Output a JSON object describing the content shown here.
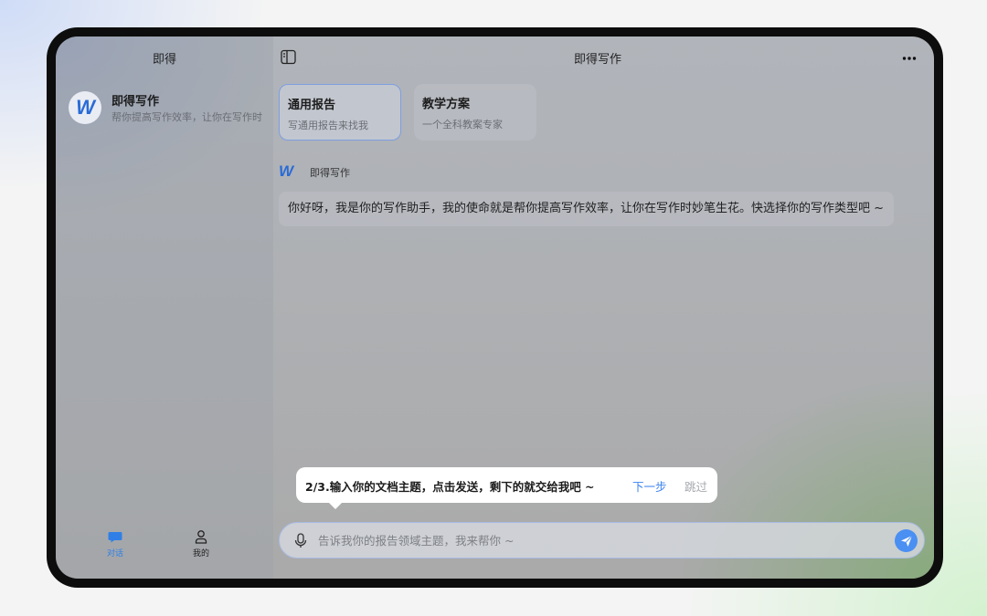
{
  "sidebar": {
    "title": "即得",
    "conversation": {
      "name": "即得写作",
      "preview": "帮你提高写作效率，让你在写作时妙笔生花",
      "logo_letter": "W"
    },
    "nav": [
      {
        "label": "对话",
        "icon": "chat-bubble-icon"
      },
      {
        "label": "我的",
        "icon": "user-icon"
      }
    ]
  },
  "header": {
    "title": "即得写作",
    "toggle_icon": "sidebar-toggle-icon",
    "more_icon": "more-icon"
  },
  "cards": [
    {
      "title": "通用报告",
      "subtitle": "写通用报告来找我"
    },
    {
      "title": "教学方案",
      "subtitle": "一个全科教案专家"
    }
  ],
  "message": {
    "sender": "即得写作",
    "logo_letter": "W",
    "text": "你好呀，我是你的写作助手，我的使命就是帮你提高写作效率，让你在写作时妙笔生花。快选择你的写作类型吧 ~"
  },
  "tooltip": {
    "text": "2/3.输入你的文档主题，点击发送，剩下的就交给我吧 ~",
    "next": "下一步",
    "skip": "跳过"
  },
  "input": {
    "placeholder": "告诉我你的报告领域主题，我来帮你 ~",
    "value": ""
  },
  "colors": {
    "accent": "#3b82f0",
    "send_button": "#4a8ff2"
  }
}
